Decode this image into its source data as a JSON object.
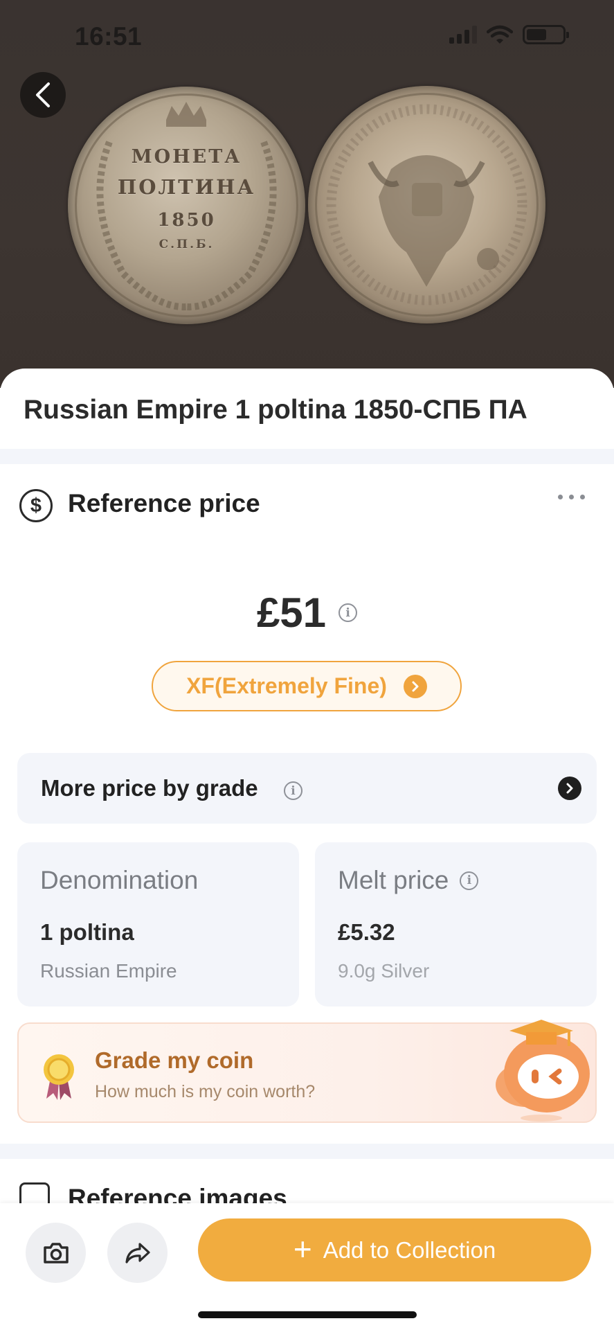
{
  "status_bar": {
    "time": "16:51"
  },
  "hero": {
    "obverse_lines": [
      "МОНЕТА",
      "ПОЛТИНА",
      "1850",
      "С.П.Б."
    ]
  },
  "coin": {
    "title": "Russian Empire 1 poltina 1850-СПБ ПА"
  },
  "reference_price": {
    "section_title": "Reference price",
    "price": "£51",
    "grade_label": "XF(Extremely Fine)"
  },
  "more_price_by_grade": {
    "label": "More price by grade"
  },
  "denomination_card": {
    "label": "Denomination",
    "value": "1 poltina",
    "sub": "Russian Empire"
  },
  "melt_card": {
    "label": "Melt price",
    "value": "£5.32",
    "sub": "9.0g Silver"
  },
  "grade_banner": {
    "title": "Grade my coin",
    "subtitle": "How much is my coin worth?"
  },
  "reference_images": {
    "section_title": "Reference images"
  },
  "bottom_bar": {
    "add_label": "Add to Collection"
  },
  "colors": {
    "accent": "#f1ac3f",
    "grade_orange": "#f0a43d",
    "banner_title": "#b06a2a",
    "card_bg": "#f3f5fa"
  },
  "icons": [
    "back-arrow-icon",
    "dollar-circle-icon",
    "more-dots-icon",
    "info-icon",
    "chevron-right-icon",
    "medal-icon",
    "mascot-icon",
    "gallery-icon",
    "camera-icon",
    "share-icon"
  ]
}
